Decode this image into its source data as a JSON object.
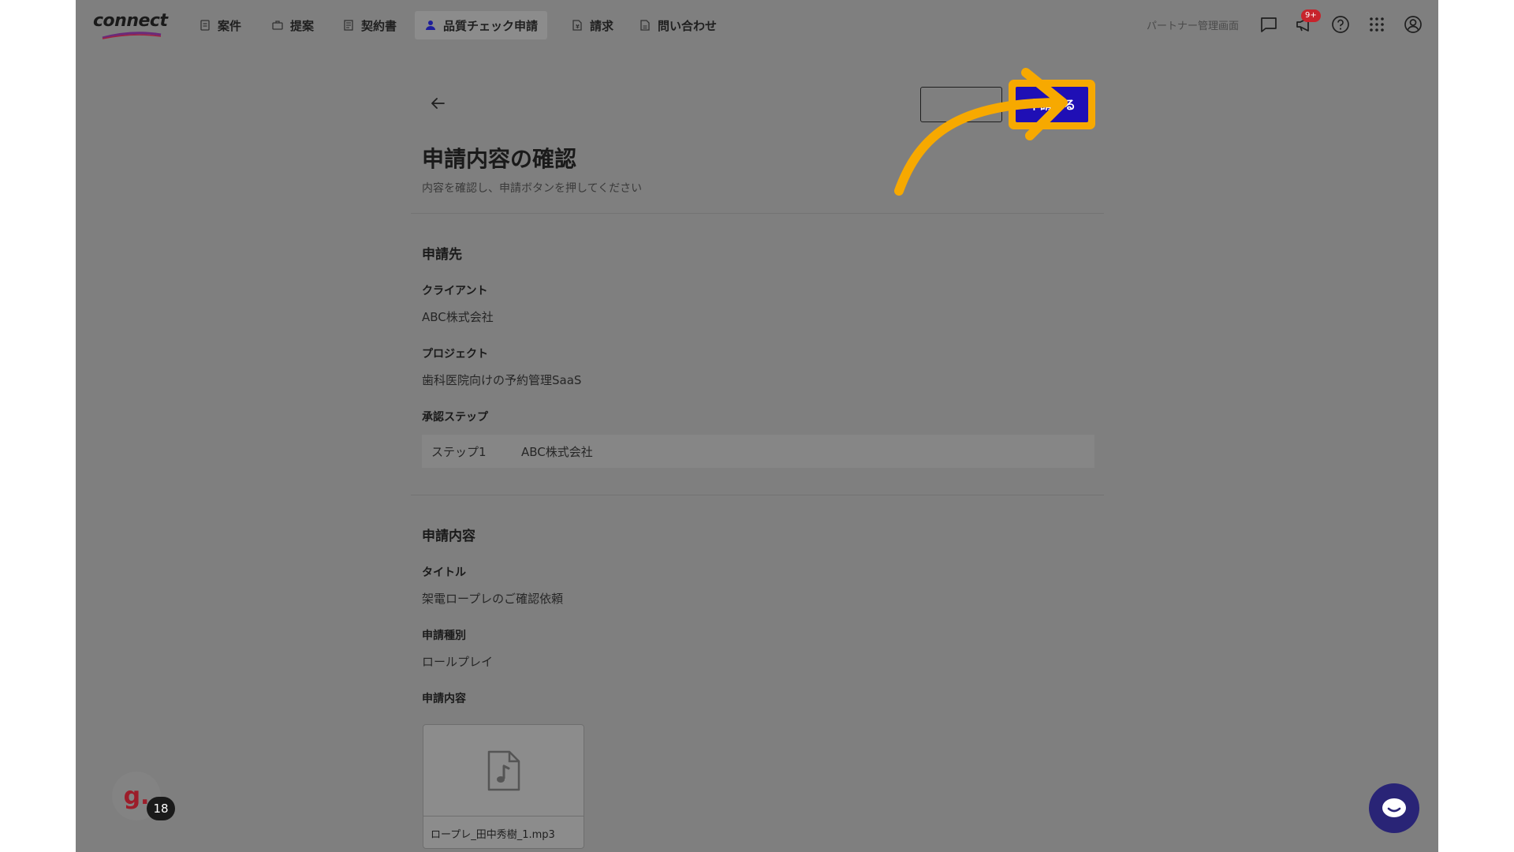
{
  "app": {
    "logo_text": "connect",
    "nav": [
      {
        "label": "案件",
        "icon": "clipboard-icon"
      },
      {
        "label": "提案",
        "icon": "briefcase-icon"
      },
      {
        "label": "契約書",
        "icon": "document-icon"
      },
      {
        "label": "品質チェック申請",
        "icon": "user-check-icon",
        "active": true
      },
      {
        "label": "請求",
        "icon": "invoice-icon"
      },
      {
        "label": "問い合わせ",
        "icon": "inquiry-icon"
      }
    ],
    "partner_link": "パートナー管理画面",
    "notification_badge": "9+"
  },
  "page": {
    "title": "申請内容の確認",
    "subtitle": "内容を確認し、申請ボタンを押してください",
    "submit_label": "申請する"
  },
  "destination": {
    "heading": "申請先",
    "client_label": "クライアント",
    "client_value": "ABC株式会社",
    "project_label": "プロジェクト",
    "project_value": "歯科医院向けの予約管理SaaS",
    "approval_label": "承認ステップ",
    "step_name": "ステップ1",
    "step_value": "ABC株式会社"
  },
  "content": {
    "heading": "申請内容",
    "title_label": "タイトル",
    "title_value": "架電ロープレのご確認依頼",
    "type_label": "申請種別",
    "type_value": "ロールプレイ",
    "content_label": "申請内容",
    "file_name": "ロープレ_田中秀樹_1.mp3"
  },
  "widgets": {
    "avatar_letter": "g.",
    "avatar_count": "18"
  },
  "colors": {
    "overlay_bg": "#7f7f7f",
    "submit_bg": "#1f0fb5",
    "highlight": "#f7a900",
    "chat_fab": "#292476"
  }
}
